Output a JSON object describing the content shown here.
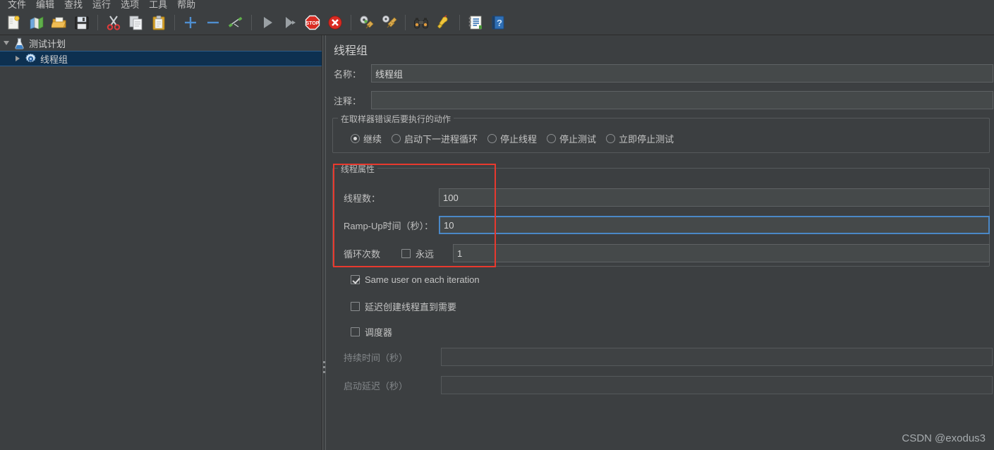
{
  "menubar": {
    "items": [
      {
        "label": "文件",
        "name": "menu-file"
      },
      {
        "label": "编辑",
        "name": "menu-edit"
      },
      {
        "label": "查找",
        "name": "menu-search"
      },
      {
        "label": "运行",
        "name": "menu-run"
      },
      {
        "label": "选项",
        "name": "menu-options"
      },
      {
        "label": "工具",
        "name": "menu-tools"
      },
      {
        "label": "帮助",
        "name": "menu-help"
      }
    ]
  },
  "toolbar": {
    "buttons": [
      {
        "icon": "new-file-icon",
        "title": "新建"
      },
      {
        "icon": "templates-icon",
        "title": "模板"
      },
      {
        "icon": "open-folder-icon",
        "title": "打开"
      },
      {
        "icon": "save-icon",
        "title": "保存"
      },
      {
        "icon": "separator",
        "title": ""
      },
      {
        "icon": "cut-icon",
        "title": "剪切"
      },
      {
        "icon": "copy-icon",
        "title": "复制"
      },
      {
        "icon": "paste-icon",
        "title": "粘贴"
      },
      {
        "icon": "separator",
        "title": ""
      },
      {
        "icon": "expand-plus-icon",
        "title": "展开"
      },
      {
        "icon": "collapse-minus-icon",
        "title": "折叠"
      },
      {
        "icon": "toggle-icon",
        "title": "切换"
      },
      {
        "icon": "separator",
        "title": ""
      },
      {
        "icon": "start-icon",
        "title": "启动"
      },
      {
        "icon": "start-no-pauses-icon",
        "title": "无间隔启动"
      },
      {
        "icon": "stop-icon",
        "title": "停止"
      },
      {
        "icon": "shutdown-icon",
        "title": "关闭"
      },
      {
        "icon": "separator",
        "title": ""
      },
      {
        "icon": "clear-icon",
        "title": "清除"
      },
      {
        "icon": "clear-all-icon",
        "title": "清除全部"
      },
      {
        "icon": "separator",
        "title": ""
      },
      {
        "icon": "search-binoculars-icon",
        "title": "查找"
      },
      {
        "icon": "reset-search-icon",
        "title": "重置查找"
      },
      {
        "icon": "separator",
        "title": ""
      },
      {
        "icon": "log-viewer-icon",
        "title": "日志查看器"
      },
      {
        "icon": "help-icon",
        "title": "帮助"
      }
    ]
  },
  "tree": {
    "nodes": [
      {
        "label": "测试计划",
        "icon": "test-plan-icon",
        "expanded": true,
        "selected": false,
        "level": 0
      },
      {
        "label": "线程组",
        "icon": "thread-group-icon",
        "expanded": false,
        "selected": true,
        "level": 1
      }
    ]
  },
  "panel": {
    "title": "线程组",
    "name_label": "名称：",
    "name_value": "线程组",
    "comment_label": "注释：",
    "comment_value": "",
    "comment_placeholder": ""
  },
  "error_action": {
    "group_title": "在取样器错误后要执行的动作",
    "options": [
      {
        "label": "继续",
        "checked": true,
        "name": "radio-continue"
      },
      {
        "label": "启动下一进程循环",
        "checked": false,
        "name": "radio-start-next-loop"
      },
      {
        "label": "停止线程",
        "checked": false,
        "name": "radio-stop-thread"
      },
      {
        "label": "停止测试",
        "checked": false,
        "name": "radio-stop-test"
      },
      {
        "label": "立即停止测试",
        "checked": false,
        "name": "radio-stop-test-now"
      }
    ]
  },
  "thread_properties": {
    "group_title": "线程属性",
    "threads_label": "线程数：",
    "threads_value": "100",
    "rampup_label": "Ramp-Up时间（秒）：",
    "rampup_value": "10",
    "rampup_focused": true,
    "loops_label": "循环次数",
    "forever_label": "永远",
    "forever_checked": false,
    "loops_value": "1",
    "highlight_color": "#e8392e"
  },
  "options": {
    "same_user_label": "Same user on each iteration",
    "same_user_checked": true,
    "delayed_start_label": "延迟创建线程直到需要",
    "delayed_start_checked": false,
    "scheduler_label": "调度器",
    "scheduler_checked": false,
    "duration_label": "持续时间（秒）",
    "duration_value": "",
    "duration_enabled": false,
    "startup_delay_label": "启动延迟（秒）",
    "startup_delay_value": "",
    "startup_delay_enabled": false
  },
  "watermark": {
    "text": "CSDN @exodus3"
  }
}
